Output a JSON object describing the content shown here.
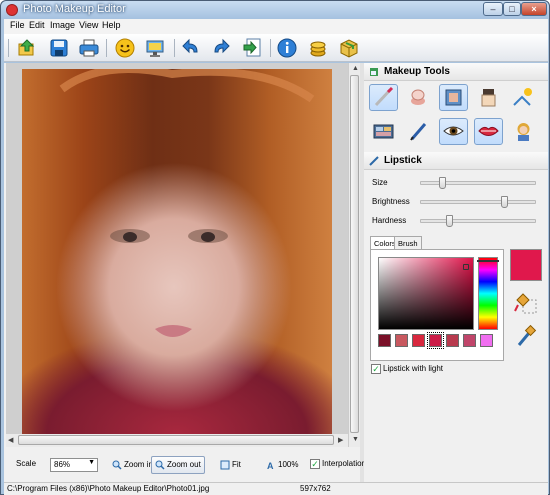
{
  "window": {
    "title": "Photo Makeup Editor",
    "minimize": "–",
    "maximize": "□",
    "close": "×"
  },
  "menu": [
    "File",
    "Edit",
    "Image",
    "View",
    "Help"
  ],
  "toolbar": {
    "buttons": [
      "open-icon",
      "save-icon",
      "print-icon",
      "smiley-icon",
      "monitor-icon",
      "undo-icon",
      "redo-icon",
      "export-icon",
      "info-icon",
      "coins-icon",
      "box-icon"
    ]
  },
  "makeup_tools": {
    "title": "Makeup Tools",
    "tools": [
      "lipstick-brush",
      "powder-puff",
      "foundation",
      "cream-jar",
      "sun-chair",
      "eyeshadow-palette",
      "eye-pencil",
      "eye",
      "lips",
      "hair"
    ],
    "active_index": 0
  },
  "lipstick": {
    "title": "Lipstick",
    "sliders": [
      {
        "label": "Size",
        "value": 0.17
      },
      {
        "label": "Brightness",
        "value": 0.74
      },
      {
        "label": "Hardness",
        "value": 0.23
      }
    ],
    "tabs": [
      "Colors",
      "Brush"
    ],
    "active_tab": 0,
    "swatches": [
      "#7a1028",
      "#c8585f",
      "#d8283e",
      "#cc1c48",
      "#b83a4e",
      "#c0456a",
      "#f06ef0"
    ],
    "selected_swatch": 3,
    "current_color": "#e0184c",
    "lipstick_with_light": "Lipstick with light",
    "lipstick_with_light_checked": true
  },
  "bottom": {
    "scale_label": "Scale",
    "scale_value": "86%",
    "zoom_in": "Zoom in",
    "zoom_out": "Zoom out",
    "fit": "Fit",
    "actual": "100%",
    "interpolation": "Interpolation",
    "interpolation_checked": true
  },
  "status": {
    "path": "C:\\Program Files (x86)\\Photo Makeup Editor\\Photo01.jpg",
    "dimensions": "597x762"
  },
  "accent_color": "#7da2ce"
}
